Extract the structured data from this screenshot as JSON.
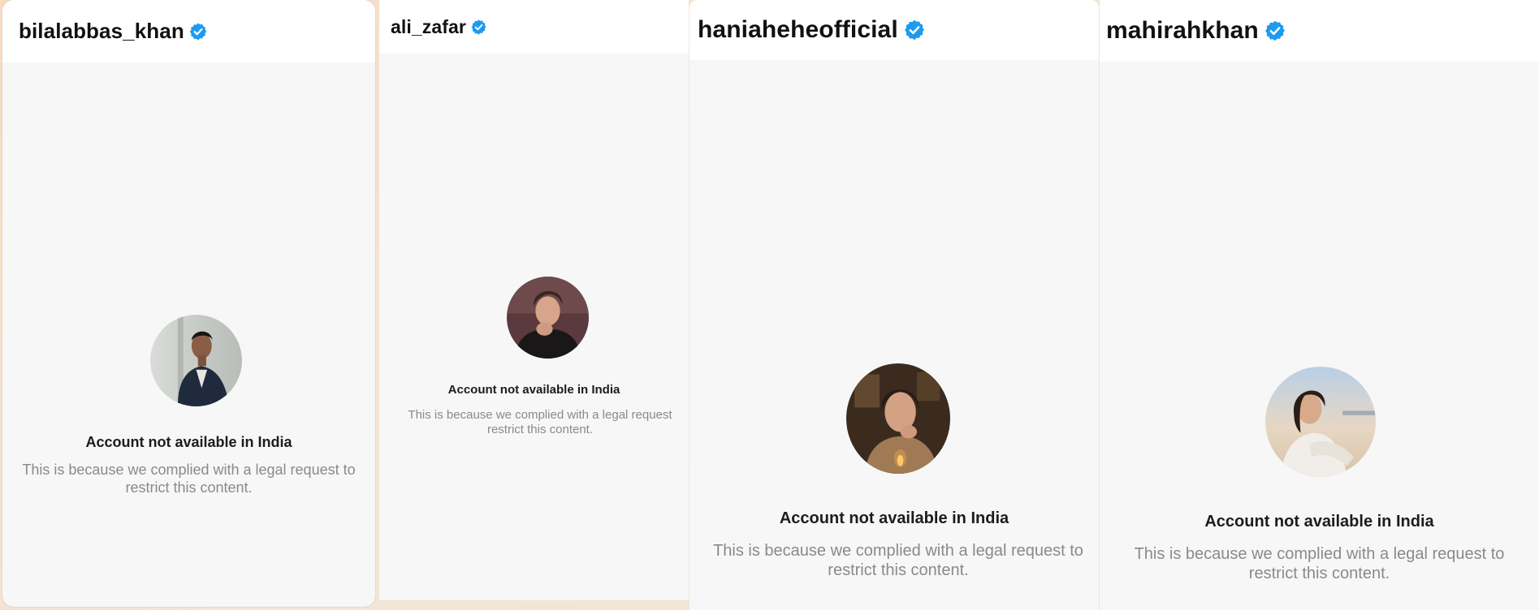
{
  "brand": {
    "verified_color": "#1d9bf0",
    "background": "#f7f7f7"
  },
  "panels": [
    {
      "username": "bilalabbas_khan",
      "verified_icon": "verified-badge-icon",
      "title": "Account not available in India",
      "message": "This is because we complied with a legal request to restrict this content."
    },
    {
      "username": "ali_zafar",
      "verified_icon": "verified-badge-icon",
      "title": "Account not available in India",
      "message": "This is because we complied with a legal request restrict this content."
    },
    {
      "username": "haniaheheofficial",
      "verified_icon": "verified-badge-icon",
      "title": "Account not available in India",
      "message": "This is because we complied with a legal request to restrict this content."
    },
    {
      "username": "mahirahkhan",
      "verified_icon": "verified-badge-icon",
      "title": "Account not available in India",
      "message": "This is because we complied with a legal request to restrict this content."
    }
  ]
}
